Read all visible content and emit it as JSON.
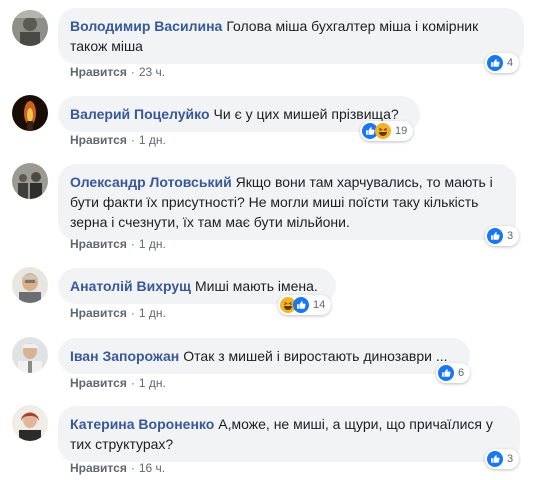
{
  "like_label": "Нравится",
  "separator": "·",
  "comments": [
    {
      "author": "Володимир Василина",
      "text": "Голова міша бухгалтер міша і комірник також міша",
      "time": "23 ч.",
      "reactions": [
        "like"
      ],
      "count": "4"
    },
    {
      "author": "Валерий Поцелуйко",
      "text": "Чи є у цих мишей прізвища?",
      "time": "1 дн.",
      "reactions": [
        "like",
        "haha"
      ],
      "count": "19"
    },
    {
      "author": "Олександр Лотовський",
      "text": "Якщо вони там харчувались, то мають і бути факти їх присутності? Не могли миші поїсти таку кількість зерна і счезнути, їх там має бути мільйони.",
      "time": "1 дн.",
      "reactions": [
        "like"
      ],
      "count": "3"
    },
    {
      "author": "Анатолій Вихрущ",
      "text": "Миші мають імена.",
      "time": "1 дн.",
      "reactions": [
        "haha",
        "like"
      ],
      "count": "14"
    },
    {
      "author": "Іван Запорожан",
      "text": "Отак з мишей і виростають динозаври ...",
      "time": "1 дн.",
      "reactions": [
        "like"
      ],
      "count": "6"
    },
    {
      "author": "Катерина Вороненко",
      "text": "А,може, не миші, а щури, що причаїлися у тих структурах?",
      "time": "16 ч.",
      "reactions": [
        "like"
      ],
      "count": "3"
    }
  ],
  "colors": {
    "author": "#385898",
    "bubble": "#f2f3f5",
    "meta": "#606770",
    "like_reaction": "#1877f2",
    "haha_reaction": "#f7b125"
  }
}
